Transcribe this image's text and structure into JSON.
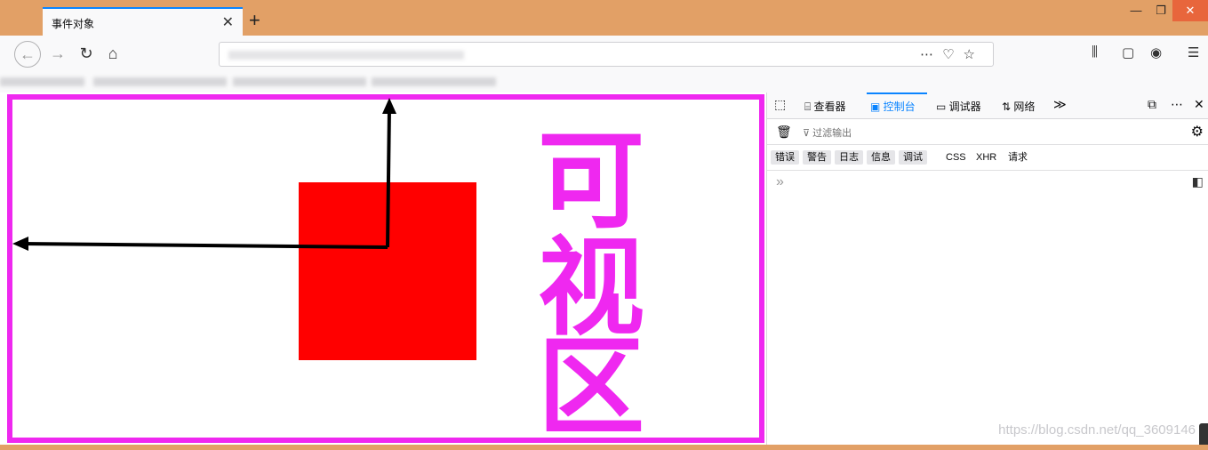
{
  "browser": {
    "tab_title": "事件对象",
    "tab_close": "✕",
    "new_tab": "+",
    "window_controls": [
      "—",
      "❐",
      "✕"
    ],
    "nav_icons": [
      "back-icon",
      "forward-icon",
      "reload-icon",
      "home-icon"
    ],
    "url_icons": [
      "more-icon",
      "pocket-icon",
      "star-icon"
    ],
    "toolbar_icons": [
      "library-icon",
      "sidebar-icon",
      "account-icon",
      "menu-icon"
    ]
  },
  "page": {
    "annotation_text": [
      "可",
      "视",
      "区"
    ],
    "colors": {
      "frame": "#ef28f0",
      "box": "#ff0000",
      "arrow": "#000000"
    }
  },
  "devtools": {
    "tabs": [
      "查看器",
      "控制台",
      "调试器",
      "网络"
    ],
    "active_tab": "控制台",
    "filter_placeholder": "过滤输出",
    "categories": [
      "错误",
      "警告",
      "日志",
      "信息",
      "调试"
    ],
    "extra_categories": [
      "CSS",
      "XHR",
      "请求"
    ],
    "prompt": "»"
  },
  "watermark": "https://blog.csdn.net/qq_3609146"
}
